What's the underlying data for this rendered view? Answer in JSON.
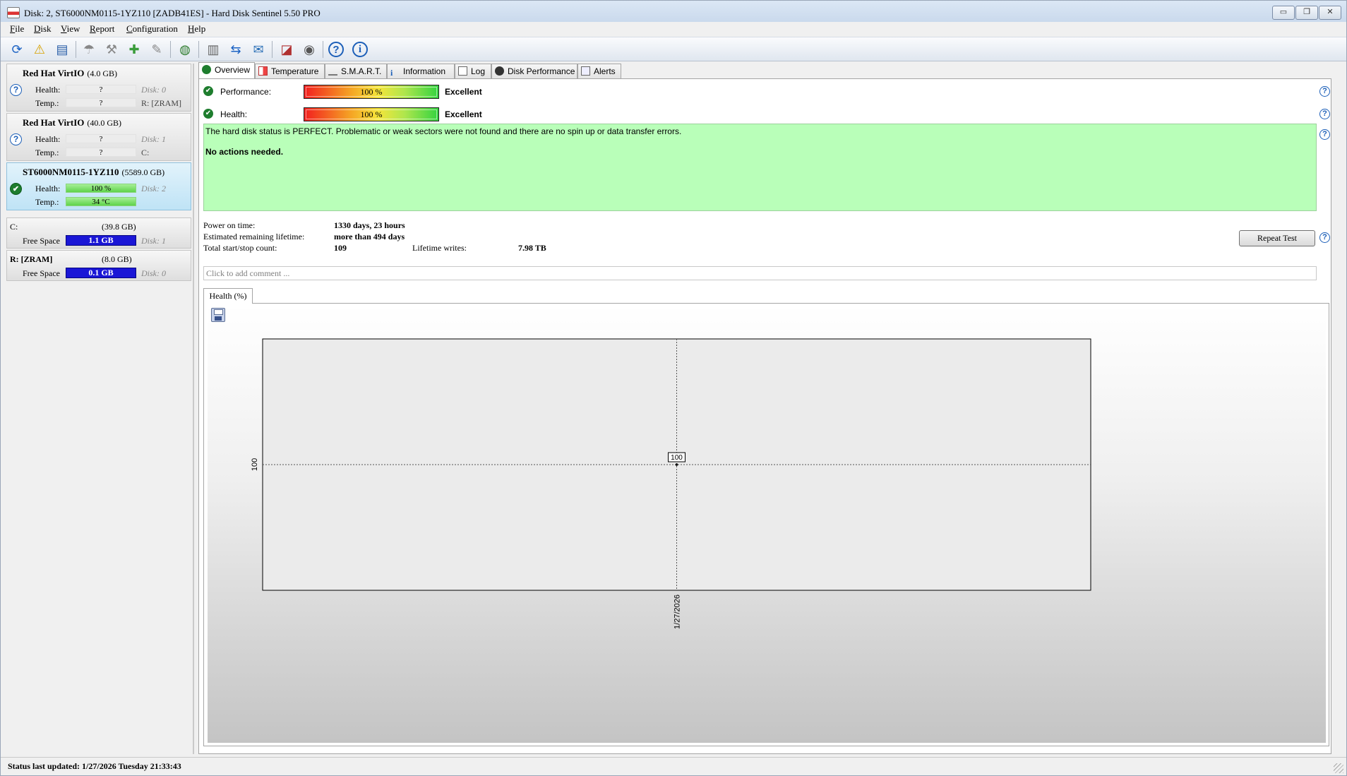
{
  "window": {
    "title": "Disk: 2, ST6000NM0115-1YZ110 [ZADB41ES]  -  Hard Disk Sentinel 5.50 PRO",
    "controls": {
      "minimize": "▭",
      "restore": "❐",
      "close": "✕"
    }
  },
  "menu": [
    "File",
    "Disk",
    "View",
    "Report",
    "Configuration",
    "Help"
  ],
  "toolbar": {
    "icons": [
      "refresh-icon",
      "alert-icon",
      "disk-report-icon",
      "disk-test-icon",
      "surface-test-icon",
      "repair-icon",
      "tools-icon",
      "web-icon",
      "text-report-icon",
      "sync-icon",
      "send-report-icon",
      "disk-control-icon",
      "sound-icon",
      "help-icon",
      "info-icon"
    ],
    "glyphs": [
      "⟳",
      "⚠",
      "▤",
      "☂",
      "⚒",
      "✚",
      "✎",
      "◍",
      "▥",
      "⇆",
      "✉",
      "◪",
      "◉",
      "?",
      "i"
    ]
  },
  "disks": [
    {
      "name": "Red Hat VirtIO",
      "size": "(4.0 GB)",
      "status": "unknown",
      "health_label": "Health:",
      "health_value": "?",
      "health_ref": "Disk: 0",
      "temp_label": "Temp.:",
      "temp_value": "?",
      "temp_ref": "R: [ZRAM]"
    },
    {
      "name": "Red Hat VirtIO",
      "size": "(40.0 GB)",
      "status": "unknown",
      "health_label": "Health:",
      "health_value": "?",
      "health_ref": "Disk: 1",
      "temp_label": "Temp.:",
      "temp_value": "?",
      "temp_ref": "C:"
    },
    {
      "name": "ST6000NM0115-1YZ110",
      "size": "(5589.0 GB)",
      "status": "ok",
      "health_label": "Health:",
      "health_value": "100 %",
      "health_ref": "Disk: 2",
      "temp_label": "Temp.:",
      "temp_value": "34 °C",
      "temp_ref": ""
    }
  ],
  "volumes": [
    {
      "name": "C:",
      "size": "(39.8 GB)",
      "free_label": "Free Space",
      "free_value": "1.1 GB",
      "disk_ref": "Disk: 1"
    },
    {
      "name": "R: [ZRAM]",
      "size": "(8.0 GB)",
      "free_label": "Free Space",
      "free_value": "0.1 GB",
      "disk_ref": "Disk: 0"
    }
  ],
  "tabs": [
    "Overview",
    "Temperature",
    "S.M.A.R.T.",
    "Information",
    "Log",
    "Disk Performance",
    "Alerts"
  ],
  "overview": {
    "performance_label": "Performance:",
    "performance_value": "100 %",
    "performance_rating": "Excellent",
    "health_label": "Health:",
    "health_value": "100 %",
    "health_rating": "Excellent",
    "status_message": "The hard disk status is PERFECT. Problematic or weak sectors were not found and there are no spin up or data transfer errors.",
    "action_message": "No actions needed.",
    "power_on_label": "Power on time:",
    "power_on_value": "1330 days, 23 hours",
    "remaining_label": "Estimated remaining lifetime:",
    "remaining_value": "more than 494 days",
    "startstop_label": "Total start/stop count:",
    "startstop_value": "109",
    "writes_label": "Lifetime writes:",
    "writes_value": "7.98 TB",
    "repeat_button": "Repeat Test",
    "comment_placeholder": "Click to add comment ...",
    "help_glyph": "?"
  },
  "chart_tab": "Health (%)",
  "chart_data": {
    "type": "line",
    "title": "",
    "xlabel": "",
    "ylabel": "",
    "x": [
      "1/27/2026"
    ],
    "series": [
      {
        "values": [
          100
        ]
      }
    ],
    "data_labels": [
      "100"
    ],
    "y_tick_labels": [
      "100"
    ],
    "grid": true
  },
  "statusbar": {
    "text": "Status last updated: 1/27/2026 Tuesday 21:33:43"
  }
}
